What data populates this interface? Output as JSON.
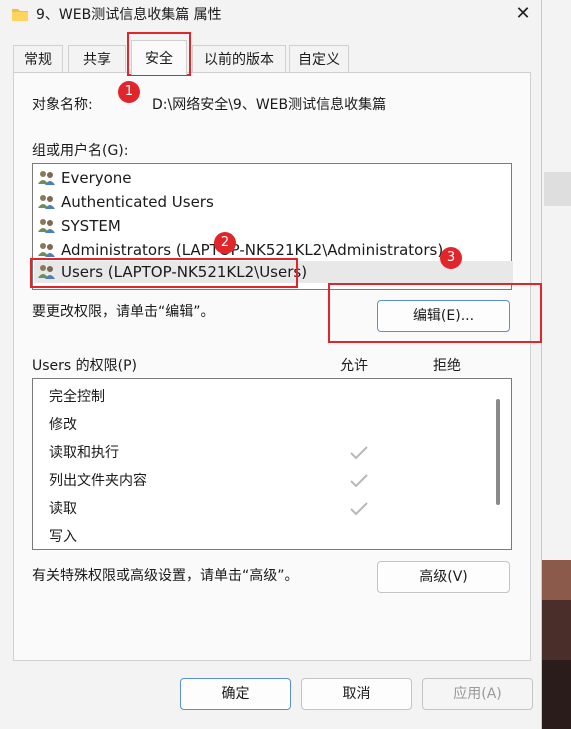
{
  "window": {
    "title": "9、WEB测试信息收集篇 属性",
    "close_glyph": "✕"
  },
  "tabs": [
    {
      "label": "常规"
    },
    {
      "label": "共享"
    },
    {
      "label": "安全"
    },
    {
      "label": "以前的版本"
    },
    {
      "label": "自定义"
    }
  ],
  "active_tab": "安全",
  "object": {
    "label": "对象名称:",
    "value": "D:\\网络安全\\9、WEB测试信息收集篇"
  },
  "groups": {
    "label": "组或用户名(G):",
    "items": [
      {
        "label": "Everyone"
      },
      {
        "label": "Authenticated Users"
      },
      {
        "label": "SYSTEM"
      },
      {
        "label": "Administrators (LAPTOP-NK521KL2\\Administrators)"
      },
      {
        "label": "Users (LAPTOP-NK521KL2\\Users)"
      }
    ],
    "selected": "Users (LAPTOP-NK521KL2\\Users)"
  },
  "change_hint": "要更改权限，请单击“编辑”。",
  "edit_button": "编辑(E)...",
  "permissions": {
    "header": "Users 的权限(P)",
    "allow_label": "允许",
    "deny_label": "拒绝",
    "rows": [
      {
        "name": "完全控制",
        "allow": false,
        "deny": false
      },
      {
        "name": "修改",
        "allow": false,
        "deny": false
      },
      {
        "name": "读取和执行",
        "allow": true,
        "deny": false
      },
      {
        "name": "列出文件夹内容",
        "allow": true,
        "deny": false
      },
      {
        "name": "读取",
        "allow": true,
        "deny": false
      },
      {
        "name": "写入",
        "allow": false,
        "deny": false
      }
    ]
  },
  "advanced_hint": "有关特殊权限或高级设置，请单击“高级”。",
  "advanced_button": "高级(V)",
  "footer": {
    "ok": "确定",
    "cancel": "取消",
    "apply": "应用(A)"
  },
  "annotations": {
    "badge1": "1",
    "badge2": "2",
    "badge3": "3",
    "color": "#e0262b"
  }
}
